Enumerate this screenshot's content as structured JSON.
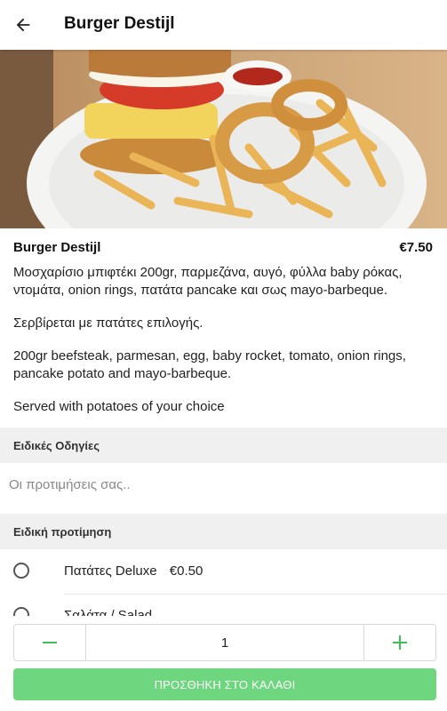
{
  "header": {
    "title": "Burger Destijl"
  },
  "item": {
    "name": "Burger Destijl",
    "price": "€7.50",
    "description": [
      "Μοσχαρίσιο μπιφτέκι 200gr, παρμεζάνα, αυγό, φύλλα baby ρόκας, ντομάτα, onion rings, πατάτα pancake και σως mayo-barbeque.",
      "Σερβίρεται με πατάτες επιλογής.",
      "200gr beefsteak, parmesan, egg, baby rocket, tomato, onion rings, pancake potato and mayo-barbeque.",
      "Served with potatoes of your choice"
    ]
  },
  "special_instructions": {
    "title": "Ειδικές Οδηγίες",
    "placeholder": "Οι προτιμήσεις σας..",
    "value": ""
  },
  "special_preference": {
    "title": "Ειδική προτίμηση",
    "options": [
      {
        "label": "Πατάτες Deluxe",
        "price": "€0.50",
        "selected": false
      },
      {
        "label": "Σαλάτα / Salad",
        "price": "",
        "selected": false
      }
    ]
  },
  "order": {
    "quantity": "1",
    "add_to_cart_label": "ΠΡΟΣΘΗΚΗ ΣΤΟ ΚΑΛΑΘΙ"
  },
  "colors": {
    "accent": "#3fbf56",
    "button_bg": "#6ed67f"
  },
  "icons": {
    "back": "arrow-left-icon",
    "minus": "minus-icon",
    "plus": "plus-icon"
  }
}
